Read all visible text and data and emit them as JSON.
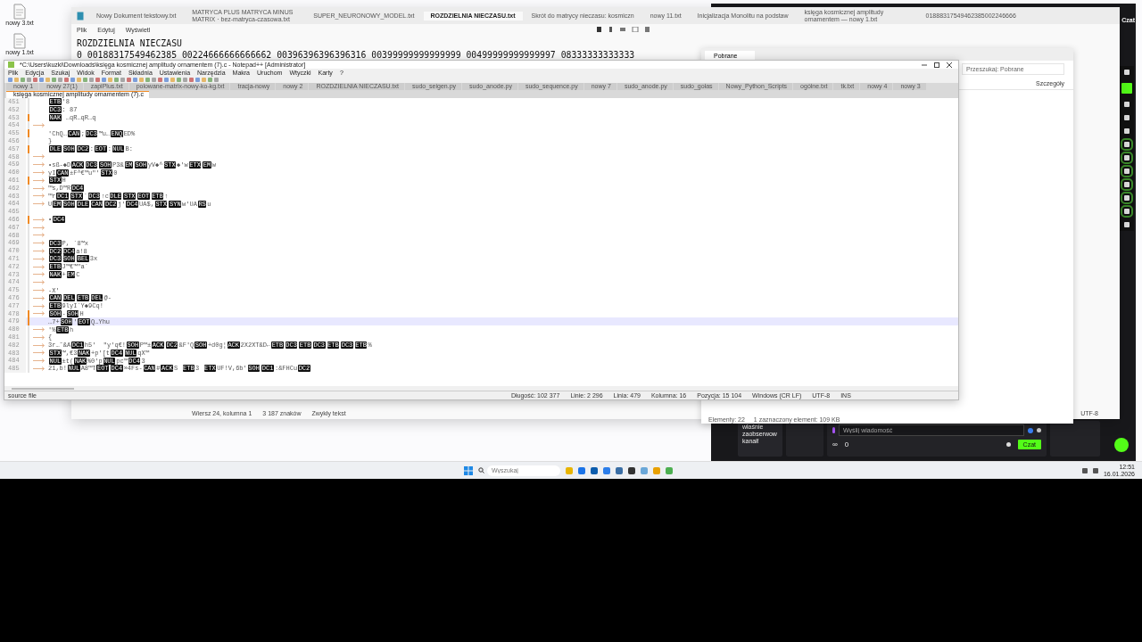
{
  "desktop_icons": [
    {
      "label": "nowy 3.txt"
    },
    {
      "label": "nowy 1.txt"
    }
  ],
  "notepad": {
    "tabs": [
      {
        "label": "Nowy Dokument tekstowy.txt",
        "selected": false
      },
      {
        "label": "MATRYCA PLUS MATRYCA MINUS MATRIX · bez-matryca-czasowa.txt",
        "selected": false
      },
      {
        "label": "SUPER_NEURONOWY_MODEL.txt",
        "selected": false
      },
      {
        "label": "ROZDZIELNIA NIECZASU.txt",
        "selected": true
      },
      {
        "label": "Skrót do matrycy nieczasu: kosmiczn",
        "selected": false
      },
      {
        "label": "nowy 11.txt",
        "selected": false
      },
      {
        "label": "Inicjalizacja Monolitu na podstaw",
        "selected": false
      },
      {
        "label": "księga kosmicznej amplitudy ornamentem — nowy 1.txt",
        "selected": false
      },
      {
        "label": "01888317549462385002246666",
        "selected": false
      }
    ],
    "menu": [
      "Plik",
      "Edytuj",
      "Wyświetl"
    ],
    "content": [
      "ROZDZIELNIA NIECZASU",
      "0 00188317549462385 00224666666666662 00396396396396316 00399999999999999 00499999999999997 08333333333333"
    ],
    "status": [
      "Wiersz 24, kolumna 1",
      "3 187 znaków",
      "Zwykły tekst"
    ],
    "encoding": "UTF-8"
  },
  "explorer": {
    "tab": "Pobrane",
    "search_placeholder": "Przeszukaj: Pobrane",
    "details": "Szczegóły",
    "status": [
      "Elementy: 22",
      "1 zaznaczony element: 109 KB"
    ]
  },
  "chat": {
    "title": "Czat",
    "notice": "właśnie zaobserwow kanał!",
    "placeholder": "Wyślij wiadomość",
    "counts": [
      "∞",
      "0"
    ],
    "button": "Czat"
  },
  "npp": {
    "title": "*C:\\Users\\kuzki\\Downloads\\księga kosmicznej amplitudy ornamentem (7).c - Notepad++ [Administrator]",
    "menu": [
      "Plik",
      "Edycja",
      "Szukaj",
      "Widok",
      "Format",
      "Składnia",
      "Ustawienia",
      "Narzędzia",
      "Makra",
      "Uruchom",
      "Wtyczki",
      "Karty",
      "?"
    ],
    "tabs": [
      {
        "label": "nowy 1",
        "selected": false
      },
      {
        "label": "nowy 27(1)",
        "selected": false
      },
      {
        "label": "zapiPlus.txt",
        "selected": false
      },
      {
        "label": "polowane-matrix-nowy-ko-kg.txt",
        "selected": false
      },
      {
        "label": "tracja-nowy",
        "selected": false
      },
      {
        "label": "nowy 2",
        "selected": false
      },
      {
        "label": "ROZDZIELNIA NIECZASU.txt",
        "selected": false
      },
      {
        "label": "sudo_seigen.py",
        "selected": false
      },
      {
        "label": "sudo_anode.py",
        "selected": false
      },
      {
        "label": "sudo_sequence.py",
        "selected": false
      },
      {
        "label": "nowy 7",
        "selected": false
      },
      {
        "label": "sudo_anode.py",
        "selected": false
      },
      {
        "label": "sudo_gołas",
        "selected": false
      },
      {
        "label": "Nowy_Python_Scripts",
        "selected": false
      },
      {
        "label": "ogólne.txt",
        "selected": false
      },
      {
        "label": "tk.txt",
        "selected": false
      },
      {
        "label": "nowy 4",
        "selected": false
      },
      {
        "label": "nowy 3",
        "selected": false
      },
      {
        "label": "księga kosmicznej amplitudy ornamentem (7).c",
        "selected": true
      }
    ],
    "lines": [
      {
        "number": "451",
        "tab": false,
        "changed": false,
        "selected": false,
        "segs": [
          {
            "kind": "ctrl",
            "text": "ETB"
          },
          {
            "kind": "plain",
            "text": "'8"
          }
        ]
      },
      {
        "number": "452",
        "tab": false,
        "changed": false,
        "selected": false,
        "segs": [
          {
            "kind": "ctrl",
            "text": "DC3"
          },
          {
            "kind": "plain",
            "text": ": 87"
          }
        ]
      },
      {
        "number": "453",
        "tab": false,
        "changed": true,
        "selected": false,
        "segs": [
          {
            "kind": "ctrl",
            "text": "NAK"
          },
          {
            "kind": "plain",
            "text": " …qR…qR…q"
          }
        ]
      },
      {
        "number": "454",
        "tab": true,
        "changed": false,
        "selected": false
      },
      {
        "number": "455",
        "tab": false,
        "changed": true,
        "selected": false,
        "segs": [
          {
            "kind": "plain",
            "text": "'ChQ…"
          },
          {
            "kind": "ctrl",
            "text": "CAN"
          },
          {
            "kind": "plain",
            "text": ";"
          },
          {
            "kind": "ctrl",
            "text": "DC3"
          },
          {
            "kind": "plain",
            "text": "™u…"
          },
          {
            "kind": "ctrl",
            "text": "ENQ"
          },
          {
            "kind": "plain",
            "text": "ED%"
          }
        ]
      },
      {
        "number": "456",
        "tab": false,
        "changed": false,
        "selected": false,
        "segs": [
          {
            "kind": "plain",
            "text": "}"
          }
        ]
      },
      {
        "number": "457",
        "tab": false,
        "changed": true,
        "selected": false,
        "segs": [
          {
            "kind": "ctrl",
            "text": "DLE"
          },
          {
            "kind": "ctrl",
            "text": "SOH"
          },
          {
            "kind": "ctrl",
            "text": "DC2"
          },
          {
            "kind": "plain",
            "text": ":"
          },
          {
            "kind": "ctrl",
            "text": "EOT"
          },
          {
            "kind": "plain",
            "text": ":"
          },
          {
            "kind": "ctrl",
            "text": "NUL"
          },
          {
            "kind": "plain",
            "text": "B:"
          }
        ]
      },
      {
        "number": "458",
        "tab": true,
        "changed": false,
        "selected": false
      },
      {
        "number": "459",
        "tab": true,
        "changed": false,
        "selected": false,
        "segs": [
          {
            "kind": "plain",
            "text": "•sß-◆D"
          },
          {
            "kind": "ctrl",
            "text": "ACK"
          },
          {
            "kind": "ctrl",
            "text": "DC3"
          },
          {
            "kind": "ctrl",
            "text": "SOH"
          },
          {
            "kind": "plain",
            "text": "P3&"
          },
          {
            "kind": "ctrl",
            "text": "EM"
          },
          {
            "kind": "ctrl",
            "text": "SOH"
          },
          {
            "kind": "plain",
            "text": "yV◆^"
          },
          {
            "kind": "ctrl",
            "text": "STX"
          },
          {
            "kind": "plain",
            "text": "◆'w"
          },
          {
            "kind": "ctrl",
            "text": "ETX"
          },
          {
            "kind": "ctrl",
            "text": "EM"
          },
          {
            "kind": "plain",
            "text": "w"
          }
        ]
      },
      {
        "number": "460",
        "tab": true,
        "changed": false,
        "selected": false,
        "segs": [
          {
            "kind": "plain",
            "text": "yI"
          },
          {
            "kind": "ctrl",
            "text": "CAN"
          },
          {
            "kind": "plain",
            "text": "±F^€™u\"'"
          },
          {
            "kind": "ctrl",
            "text": "STX"
          },
          {
            "kind": "plain",
            "text": "0"
          }
        ]
      },
      {
        "number": "461",
        "tab": true,
        "changed": true,
        "selected": false,
        "segs": [
          {
            "kind": "ctrl",
            "text": "STX"
          },
          {
            "kind": "plain",
            "text": "H"
          }
        ]
      },
      {
        "number": "462",
        "tab": true,
        "changed": false,
        "selected": false,
        "segs": [
          {
            "kind": "plain",
            "text": "™s,D™R"
          },
          {
            "kind": "ctrl",
            "text": "DC4"
          }
        ]
      },
      {
        "number": "463",
        "tab": true,
        "changed": false,
        "selected": false,
        "segs": [
          {
            "kind": "plain",
            "text": "™r"
          },
          {
            "kind": "ctrl",
            "text": "DC1"
          },
          {
            "kind": "ctrl",
            "text": "STX"
          },
          {
            "kind": "plain",
            "text": "`"
          },
          {
            "kind": "ctrl",
            "text": "DC3"
          },
          {
            "kind": "plain",
            "text": "↑c"
          },
          {
            "kind": "ctrl",
            "text": "DLE"
          },
          {
            "kind": "ctrl",
            "text": "STX"
          },
          {
            "kind": "ctrl",
            "text": "EOT"
          },
          {
            "kind": "ctrl",
            "text": "ETB"
          },
          {
            "kind": "plain",
            "text": "↑"
          }
        ]
      },
      {
        "number": "464",
        "tab": true,
        "changed": false,
        "selected": false,
        "segs": [
          {
            "kind": "plain",
            "text": "U"
          },
          {
            "kind": "ctrl",
            "text": "EM"
          },
          {
            "kind": "ctrl",
            "text": "SOH"
          },
          {
            "kind": "ctrl",
            "text": "DLE"
          },
          {
            "kind": "ctrl",
            "text": "CAN"
          },
          {
            "kind": "ctrl",
            "text": "DC2"
          },
          {
            "kind": "plain",
            "text": "j'"
          },
          {
            "kind": "ctrl",
            "text": "DC4"
          },
          {
            "kind": "plain",
            "text": "UA$,"
          },
          {
            "kind": "ctrl",
            "text": "STX"
          },
          {
            "kind": "ctrl",
            "text": "SYN"
          },
          {
            "kind": "plain",
            "text": "w'UA"
          },
          {
            "kind": "ctrl",
            "text": "RS"
          },
          {
            "kind": "plain",
            "text": "u"
          }
        ]
      },
      {
        "number": "465",
        "tab": false,
        "changed": false,
        "selected": false
      },
      {
        "number": "466",
        "tab": true,
        "changed": true,
        "selected": false,
        "segs": [
          {
            "kind": "plain",
            "text": "•"
          },
          {
            "kind": "ctrl",
            "text": "DC4"
          }
        ]
      },
      {
        "number": "467",
        "tab": true,
        "changed": false,
        "selected": false
      },
      {
        "number": "468",
        "tab": true,
        "changed": false,
        "selected": false
      },
      {
        "number": "469",
        "tab": true,
        "changed": false,
        "selected": false,
        "segs": [
          {
            "kind": "ctrl",
            "text": "DC3"
          },
          {
            "kind": "plain",
            "text": "P, `8™x"
          }
        ]
      },
      {
        "number": "470",
        "tab": true,
        "changed": false,
        "selected": false,
        "segs": [
          {
            "kind": "ctrl",
            "text": "DC2"
          },
          {
            "kind": "ctrl",
            "text": "DC4"
          },
          {
            "kind": "plain",
            "text": "a!8"
          }
        ]
      },
      {
        "number": "471",
        "tab": true,
        "changed": false,
        "selected": false,
        "segs": [
          {
            "kind": "ctrl",
            "text": "DC3"
          },
          {
            "kind": "ctrl",
            "text": "SOH"
          },
          {
            "kind": "ctrl",
            "text": "BEL"
          },
          {
            "kind": "plain",
            "text": "3x"
          }
        ]
      },
      {
        "number": "472",
        "tab": true,
        "changed": false,
        "selected": false,
        "segs": [
          {
            "kind": "ctrl",
            "text": "ETB"
          },
          {
            "kind": "plain",
            "text": "J™€™\"a`"
          }
        ]
      },
      {
        "number": "473",
        "tab": true,
        "changed": false,
        "selected": false,
        "segs": [
          {
            "kind": "ctrl",
            "text": "NAK"
          },
          {
            "kind": "plain",
            "text": "+"
          },
          {
            "kind": "ctrl",
            "text": "EM"
          },
          {
            "kind": "plain",
            "text": "C"
          }
        ]
      },
      {
        "number": "474",
        "tab": true,
        "changed": false,
        "selected": false
      },
      {
        "number": "475",
        "tab": true,
        "changed": false,
        "selected": false,
        "segs": [
          {
            "kind": "plain",
            "text": "-X'"
          }
        ]
      },
      {
        "number": "476",
        "tab": true,
        "changed": false,
        "selected": false,
        "segs": [
          {
            "kind": "ctrl",
            "text": "CAN"
          },
          {
            "kind": "ctrl",
            "text": "DEL"
          },
          {
            "kind": "ctrl",
            "text": "ETB"
          },
          {
            "kind": "ctrl",
            "text": "DEL"
          },
          {
            "kind": "plain",
            "text": "@-"
          }
        ]
      },
      {
        "number": "477",
        "tab": true,
        "changed": false,
        "selected": false,
        "segs": [
          {
            "kind": "ctrl",
            "text": "ETB"
          },
          {
            "kind": "plain",
            "text": "9lyI`Y◆9Cq!"
          }
        ]
      },
      {
        "number": "478",
        "tab": true,
        "changed": true,
        "selected": false,
        "segs": [
          {
            "kind": "ctrl",
            "text": "SOH"
          },
          {
            "kind": "plain",
            "text": "-"
          },
          {
            "kind": "ctrl",
            "text": "SOH"
          },
          {
            "kind": "plain",
            "text": "H"
          }
        ]
      },
      {
        "number": "479",
        "tab": false,
        "changed": true,
        "selected": true,
        "segs": [
          {
            "kind": "plain",
            "text": "…7+"
          },
          {
            "kind": "ctrl",
            "text": "SOH"
          },
          {
            "kind": "plain",
            "text": "'"
          },
          {
            "kind": "ctrl",
            "text": "EOT"
          },
          {
            "kind": "plain",
            "text": "Q…Yhu"
          }
        ]
      },
      {
        "number": "480",
        "tab": true,
        "changed": false,
        "selected": false,
        "segs": [
          {
            "kind": "plain",
            "text": "'%"
          },
          {
            "kind": "ctrl",
            "text": "ETB"
          },
          {
            "kind": "plain",
            "text": "h"
          }
        ]
      },
      {
        "number": "481",
        "tab": true,
        "changed": false,
        "selected": false,
        "segs": [
          {
            "kind": "plain",
            "text": "{"
          }
        ]
      },
      {
        "number": "482",
        "tab": true,
        "changed": false,
        "selected": false,
        "segs": [
          {
            "kind": "plain",
            "text": "3r…˜&A"
          },
          {
            "kind": "ctrl",
            "text": "DC1"
          },
          {
            "kind": "plain",
            "text": "h5'  \"y'q€!"
          },
          {
            "kind": "ctrl",
            "text": "SOH"
          },
          {
            "kind": "plain",
            "text": "P™±"
          },
          {
            "kind": "ctrl",
            "text": "ACK"
          },
          {
            "kind": "ctrl",
            "text": "DC2"
          },
          {
            "kind": "plain",
            "text": "&F'Q"
          },
          {
            "kind": "ctrl",
            "text": "SOH"
          },
          {
            "kind": "plain",
            "text": "+d0g¦"
          },
          {
            "kind": "ctrl",
            "text": "ACK"
          },
          {
            "kind": "plain",
            "text": "2X2XT&D←"
          },
          {
            "kind": "ctrl",
            "text": "ETB"
          },
          {
            "kind": "ctrl",
            "text": "DC3"
          },
          {
            "kind": "ctrl",
            "text": "ETB"
          },
          {
            "kind": "ctrl",
            "text": "DC3"
          },
          {
            "kind": "ctrl",
            "text": "ETB"
          },
          {
            "kind": "ctrl",
            "text": "DC3"
          },
          {
            "kind": "ctrl",
            "text": "ETB"
          },
          {
            "kind": "plain",
            "text": "%"
          }
        ]
      },
      {
        "number": "483",
        "tab": true,
        "changed": false,
        "selected": false,
        "segs": [
          {
            "kind": "ctrl",
            "text": "STX"
          },
          {
            "kind": "plain",
            "text": "™,€3"
          },
          {
            "kind": "ctrl",
            "text": "NAK"
          },
          {
            "kind": "plain",
            "text": "+p'[t"
          },
          {
            "kind": "ctrl",
            "text": "DC4"
          },
          {
            "kind": "ctrl",
            "text": "NUL"
          },
          {
            "kind": "plain",
            "text": "qX™"
          }
        ]
      },
      {
        "number": "484",
        "tab": true,
        "changed": false,
        "selected": false,
        "segs": [
          {
            "kind": "ctrl",
            "text": "NUL"
          },
          {
            "kind": "plain",
            "text": "±t("
          },
          {
            "kind": "ctrl",
            "text": "NAK"
          },
          {
            "kind": "plain",
            "text": "%0'p"
          },
          {
            "kind": "ctrl",
            "text": "NUL"
          },
          {
            "kind": "plain",
            "text": "pc™"
          },
          {
            "kind": "ctrl",
            "text": "DC4"
          },
          {
            "kind": "plain",
            "text": "3"
          }
        ]
      },
      {
        "number": "485",
        "tab": true,
        "changed": false,
        "selected": false,
        "segs": [
          {
            "kind": "plain",
            "text": "21,b!"
          },
          {
            "kind": "ctrl",
            "text": "NUL"
          },
          {
            "kind": "plain",
            "text": "A8™T"
          },
          {
            "kind": "ctrl",
            "text": "EOT"
          },
          {
            "kind": "ctrl",
            "text": "DC4"
          },
          {
            "kind": "plain",
            "text": "»4Fs-"
          },
          {
            "kind": "ctrl",
            "text": "CAN"
          },
          {
            "kind": "plain",
            "text": "#"
          },
          {
            "kind": "ctrl",
            "text": "ACK"
          },
          {
            "kind": "plain",
            "text": "S "
          },
          {
            "kind": "ctrl",
            "text": "ETB"
          },
          {
            "kind": "plain",
            "text": "3 "
          },
          {
            "kind": "ctrl",
            "text": "ETX"
          },
          {
            "kind": "plain",
            "text": "UF!V,6b'"
          },
          {
            "kind": "ctrl",
            "text": "SOH"
          },
          {
            "kind": "ctrl",
            "text": "DC1"
          },
          {
            "kind": "plain",
            "text": ":&FHCu"
          },
          {
            "kind": "ctrl",
            "text": "DC2"
          }
        ]
      }
    ],
    "file_type": "source file",
    "status": [
      "Długość: 102 377",
      "Linie: 2 296",
      "Linia: 479",
      "Kolumna: 16",
      "Pozycja: 15 104",
      "Windows (CR LF)",
      "UTF-8",
      "INS"
    ]
  },
  "taskbar": {
    "search_placeholder": "Wyszukaj",
    "time": "12:51",
    "date": "16.01.2026"
  }
}
